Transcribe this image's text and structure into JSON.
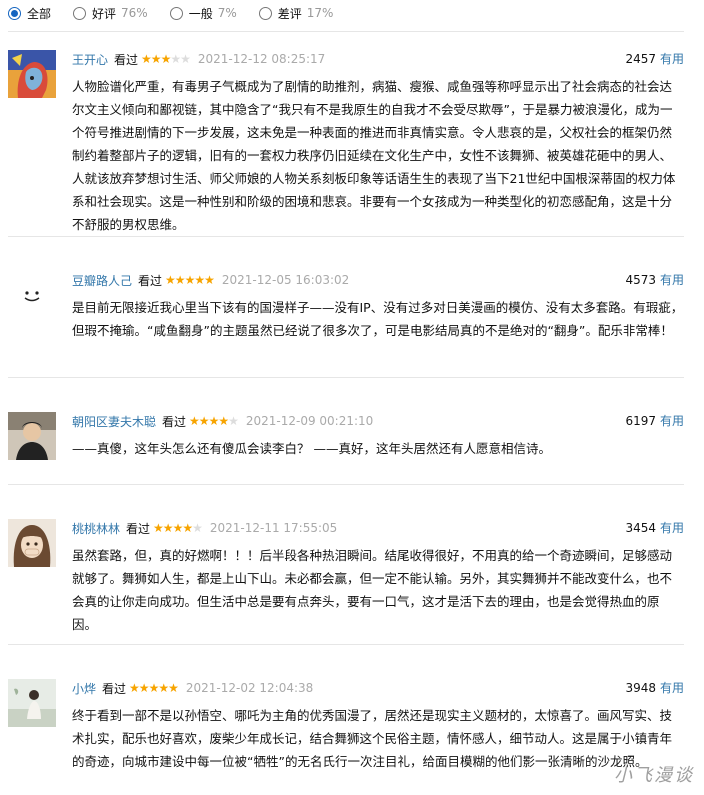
{
  "filters": [
    {
      "label": "全部",
      "pct": "",
      "checked": true
    },
    {
      "label": "好评",
      "pct": "76%",
      "checked": false
    },
    {
      "label": "一般",
      "pct": "7%",
      "checked": false
    },
    {
      "label": "差评",
      "pct": "17%",
      "checked": false
    }
  ],
  "reviews": [
    {
      "user": "王开心",
      "watched": "看过",
      "stars": 3,
      "time": "2021-12-12 08:25:17",
      "votes": "2457",
      "useful": "有用",
      "content": "人物脸谱化严重，有毒男子气概成为了剧情的助推剂，病猫、瘦猴、咸鱼强等称呼显示出了社会病态的社会达尔文主义倾向和鄙视链，其中隐含了“我只有不是我原生的自我才不会受尽欺辱”，于是暴力被浪漫化，成为一个符号推进剧情的下一步发展，这未免是一种表面的推进而非真情实意。令人悲哀的是，父权社会的框架仍然制约着整部片子的逻辑，旧有的一套权力秩序仍旧延续在文化生产中，女性不该舞狮、被英雄花砸中的男人、人就该放弃梦想讨生活、师父师娘的人物关系刻板印象等话语生生的表现了当下21世纪中国根深蒂固的权力体系和社会现实。这是一种性别和阶级的困境和悲哀。非要有一个女孩成为一种类型化的初恋感配角，这是十分不舒服的男权思维。"
    },
    {
      "user": "豆瓣路人己",
      "watched": "看过",
      "stars": 5,
      "time": "2021-12-05 16:03:02",
      "votes": "4573",
      "useful": "有用",
      "content": "是目前无限接近我心里当下该有的国漫样子——没有IP、没有过多对日美漫画的模仿、没有太多套路。有瑕疵，但瑕不掩瑜。“咸鱼翻身”的主题虽然已经说了很多次了，可是电影结局真的不是绝对的“翻身”。配乐非常棒！"
    },
    {
      "user": "朝阳区妻夫木聪",
      "watched": "看过",
      "stars": 4,
      "time": "2021-12-09 00:21:10",
      "votes": "6197",
      "useful": "有用",
      "content": "——真傻，这年头怎么还有傻瓜会读李白？ ——真好，这年头居然还有人愿意相信诗。"
    },
    {
      "user": "桃桃林林",
      "watched": "看过",
      "stars": 4,
      "time": "2021-12-11 17:55:05",
      "votes": "3454",
      "useful": "有用",
      "content": "虽然套路，但，真的好燃啊！！！后半段各种热泪瞬间。结尾收得很好，不用真的给一个奇迹瞬间，足够感动就够了。舞狮如人生，都是上山下山。未必都会赢，但一定不能认输。另外，其实舞狮并不能改变什么，也不会真的让你走向成功。但生活中总是要有点奔头，要有一口气，这才是活下去的理由，也是会觉得热血的原因。"
    },
    {
      "user": "小烨",
      "watched": "看过",
      "stars": 5,
      "time": "2021-12-02 12:04:38",
      "votes": "3948",
      "useful": "有用",
      "content": "终于看到一部不是以孙悟空、哪吒为主角的优秀国漫了，居然还是现实主义题材的，太惊喜了。画风写实、技术扎实，配乐也好喜欢，废柴少年成长记，结合舞狮这个民俗主题，情怀感人，细节动人。这是属于小镇青年的奇迹，向城市建设中每一位被“牺牲”的无名氏行一次注目礼，给面目模糊的他们影一张清晰的沙龙照。"
    }
  ],
  "watermark": "小飞漫谈"
}
